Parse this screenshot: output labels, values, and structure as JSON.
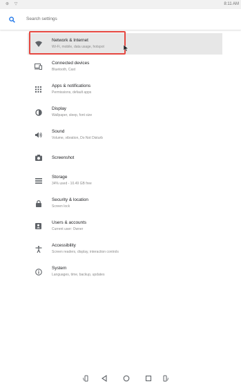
{
  "status_bar": {
    "time": "8:11 AM"
  },
  "search": {
    "placeholder": "Search settings"
  },
  "settings": [
    {
      "title": "Network & Internet",
      "subtitle": "Wi-Fi, mobile, data usage, hotspot",
      "icon": "wifi-icon",
      "selected": true
    },
    {
      "title": "Connected devices",
      "subtitle": "Bluetooth, Cast",
      "icon": "devices-icon"
    },
    {
      "title": "Apps & notifications",
      "subtitle": "Permissions, default apps",
      "icon": "apps-icon"
    },
    {
      "title": "Display",
      "subtitle": "Wallpaper, sleep, font size",
      "icon": "brightness-icon"
    },
    {
      "title": "Sound",
      "subtitle": "Volume, vibration, Do Not Disturb",
      "icon": "volume-icon"
    },
    {
      "title": "Screenshot",
      "subtitle": "",
      "icon": "camera-icon"
    },
    {
      "title": "Storage",
      "subtitle": "34% used - 10.49 GB free",
      "icon": "storage-icon"
    },
    {
      "title": "Security & location",
      "subtitle": "Screen lock",
      "icon": "lock-icon"
    },
    {
      "title": "Users & accounts",
      "subtitle": "Current user: Owner",
      "icon": "account-icon"
    },
    {
      "title": "Accessibility",
      "subtitle": "Screen readers, display, interaction controls",
      "icon": "accessibility-icon"
    },
    {
      "title": "System",
      "subtitle": "Languages, time, backup, updates",
      "icon": "info-icon"
    }
  ],
  "colors": {
    "highlight": "#e5463f",
    "accent": "#1a73e8"
  }
}
